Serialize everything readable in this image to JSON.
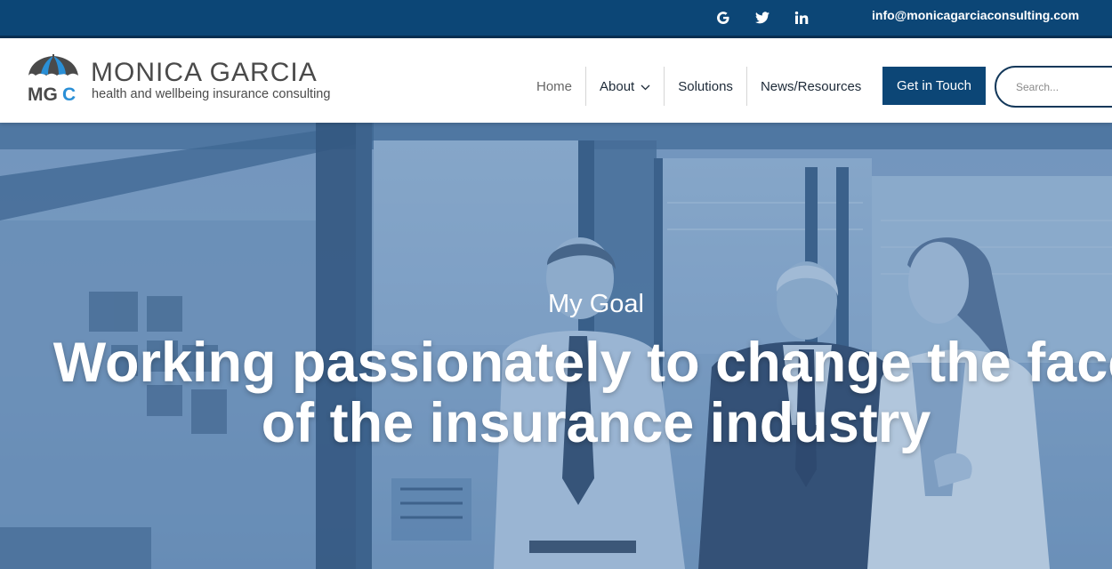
{
  "topbar": {
    "social": [
      {
        "name": "google",
        "icon": "google-icon"
      },
      {
        "name": "twitter",
        "icon": "twitter-icon"
      },
      {
        "name": "linkedin",
        "icon": "linkedin-icon"
      }
    ],
    "email": "info@monicagarciaconsulting.com"
  },
  "header": {
    "logo": {
      "name": "MONICA GARCIA",
      "tagline": "health and wellbeing insurance consulting",
      "mark_initials_dark": "MG",
      "mark_initials_accent": "C",
      "icon": "umbrella-icon"
    },
    "nav": [
      {
        "label": "Home",
        "active": true
      },
      {
        "label": "About",
        "dropdown": true,
        "icon": "chevron-down-icon"
      },
      {
        "label": "Solutions"
      },
      {
        "label": "News/Resources"
      }
    ],
    "cta_label": "Get in Touch",
    "search_placeholder": "Search..."
  },
  "hero": {
    "kicker": "My Goal",
    "title_line1": "Working passionately to change the face",
    "title_line2": "of the insurance industry"
  },
  "colors": {
    "brand_navy": "#0c4676",
    "accent_blue": "#2a8fd6",
    "hero_overlay": "#5b86b4",
    "text_dark": "#1d2a38",
    "logo_gray": "#4a4a4a"
  }
}
